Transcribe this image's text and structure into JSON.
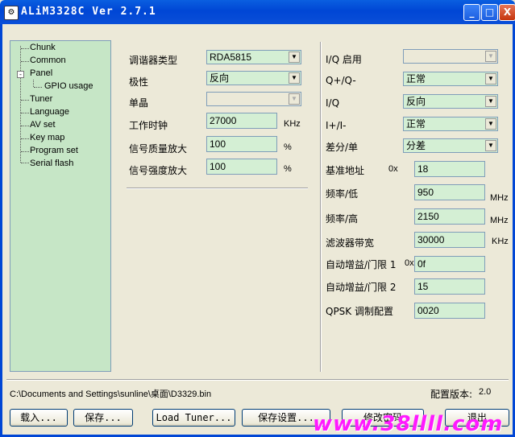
{
  "window": {
    "title": "ALiM3328C Ver 2.7.1"
  },
  "titlebar": {
    "minimize": "_",
    "maximize": "□",
    "close": "X"
  },
  "tree": {
    "items": [
      {
        "label": "Chunk"
      },
      {
        "label": "Common"
      },
      {
        "label": "Panel",
        "expander": "-"
      },
      {
        "label": "GPIO usage"
      },
      {
        "label": "Tuner"
      },
      {
        "label": "Language"
      },
      {
        "label": "AV set"
      },
      {
        "label": "Key map"
      },
      {
        "label": "Program set"
      },
      {
        "label": "Serial flash"
      }
    ]
  },
  "left": {
    "tuner_type": {
      "label": "调谐器类型",
      "value": "RDA5815"
    },
    "polarity": {
      "label": "极性",
      "value": "反向"
    },
    "crystal": {
      "label": "单晶",
      "value": ""
    },
    "clock": {
      "label": "工作时钟",
      "value": "27000",
      "unit": "KHz"
    },
    "quality": {
      "label": "信号质量放大",
      "value": "100",
      "unit": "%"
    },
    "strength": {
      "label": "信号强度放大",
      "value": "100",
      "unit": "%"
    }
  },
  "right": {
    "iq_enable": {
      "label": "I/Q 启用",
      "value": ""
    },
    "qpm": {
      "label": "Q+/Q-",
      "value": "正常"
    },
    "iq": {
      "label": "I/Q",
      "value": "反向"
    },
    "ipm": {
      "label": "I+/I-",
      "value": "正常"
    },
    "diff": {
      "label": "差分/单",
      "value": "分差"
    },
    "base_addr": {
      "label": "基准地址",
      "prefix": "0x",
      "value": "18"
    },
    "freq_low": {
      "label": "频率/低",
      "value": "950",
      "unit": "MHz"
    },
    "freq_high": {
      "label": "频率/高",
      "value": "2150",
      "unit": "MHz"
    },
    "bandwidth": {
      "label": "滤波器带宽",
      "value": "30000",
      "unit": "KHz"
    },
    "agc1": {
      "label": "自动增益/门限 1",
      "prefix": "0x",
      "value": "0f"
    },
    "agc2": {
      "label": "自动增益/门限 2",
      "value": "15"
    },
    "qpsk": {
      "label": "QPSK 调制配置",
      "value": "0020"
    }
  },
  "status": {
    "path": "C:\\Documents and Settings\\sunline\\桌面\\D3329.bin",
    "version_label": "配置版本:",
    "version": "2.0"
  },
  "buttons": {
    "load": "载入...",
    "save": "保存...",
    "load_tuner": "Load Tuner...",
    "save_settings": "保存设置...",
    "change_password": "修改密码",
    "exit": "退出"
  },
  "watermark": "www.38llll.com"
}
